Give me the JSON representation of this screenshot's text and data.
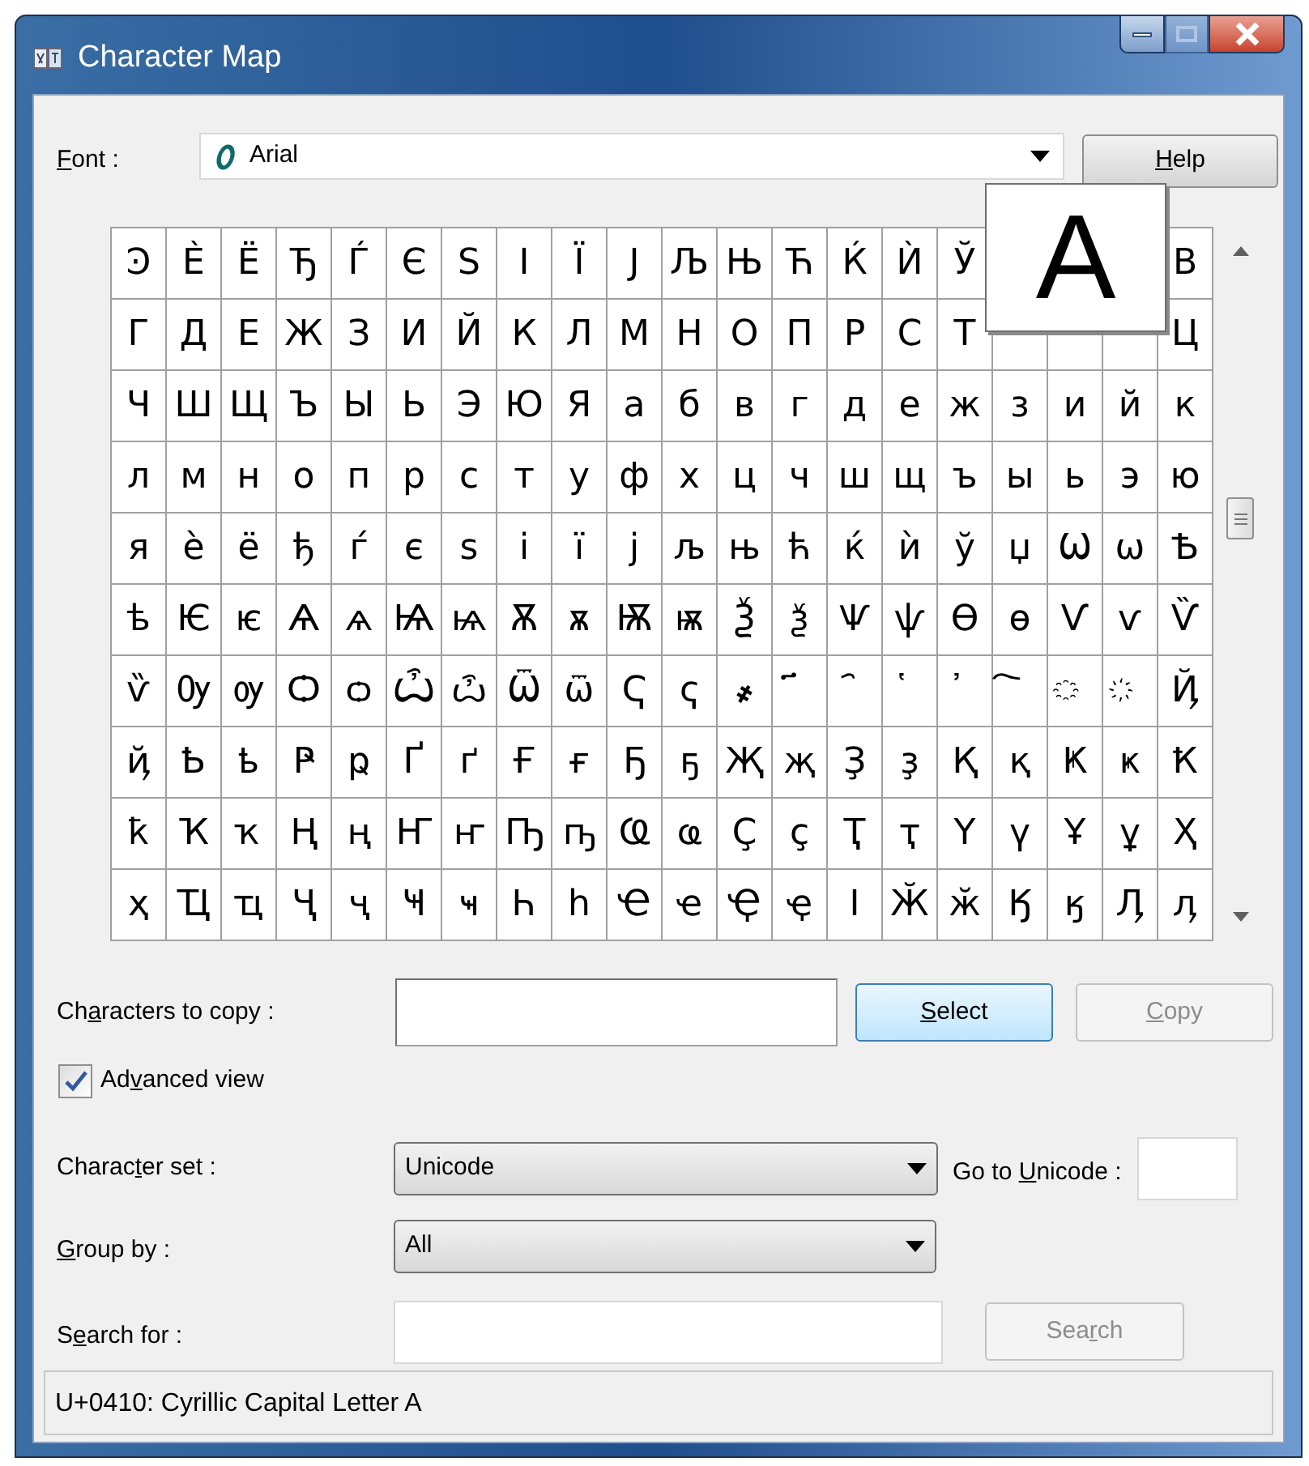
{
  "window": {
    "title": "Character Map",
    "buttons": [
      {
        "kind": "minimize",
        "disabled": false
      },
      {
        "kind": "maximize",
        "disabled": true
      },
      {
        "kind": "close",
        "disabled": false
      }
    ]
  },
  "font": {
    "label": {
      "key": "F",
      "after": "ont :"
    },
    "value": "Arial"
  },
  "help_button": {
    "key": "H",
    "after": "elp"
  },
  "grid": {
    "rows": [
      [
        "Ͽ",
        "Ѐ",
        "Ё",
        "Ђ",
        "Ѓ",
        "Є",
        "Ѕ",
        "І",
        "Ї",
        "Ј",
        "Љ",
        "Њ",
        "Ћ",
        "Ќ",
        "Ѝ",
        "Ў",
        null,
        null,
        null,
        "В"
      ],
      [
        "Г",
        "Д",
        "Е",
        "Ж",
        "З",
        "И",
        "Й",
        "К",
        "Л",
        "М",
        "Н",
        "О",
        "П",
        "Р",
        "С",
        "Т",
        null,
        null,
        null,
        "Ц"
      ],
      [
        "Ч",
        "Ш",
        "Щ",
        "Ъ",
        "Ы",
        "Ь",
        "Э",
        "Ю",
        "Я",
        "а",
        "б",
        "в",
        "г",
        "д",
        "е",
        "ж",
        "з",
        "и",
        "й",
        "к"
      ],
      [
        "л",
        "м",
        "н",
        "о",
        "п",
        "р",
        "с",
        "т",
        "у",
        "ф",
        "х",
        "ц",
        "ч",
        "ш",
        "щ",
        "ъ",
        "ы",
        "ь",
        "э",
        "ю"
      ],
      [
        "я",
        "ѐ",
        "ё",
        "ђ",
        "ѓ",
        "є",
        "ѕ",
        "і",
        "ї",
        "ј",
        "љ",
        "њ",
        "ћ",
        "ќ",
        "ѝ",
        "ў",
        "џ",
        "Ѡ",
        "ѡ",
        "Ѣ"
      ],
      [
        "ѣ",
        "Ѥ",
        "ѥ",
        "Ѧ",
        "ѧ",
        "Ѩ",
        "ѩ",
        "Ѫ",
        "ѫ",
        "Ѭ",
        "ѭ",
        "Ѯ",
        "ѯ",
        "Ѱ",
        "ѱ",
        "Ѳ",
        "ѳ",
        "Ѵ",
        "ѵ",
        "Ѷ"
      ],
      [
        "ѷ",
        "Ѹ",
        "ѹ",
        "Ѻ",
        "ѻ",
        "Ѽ",
        "ѽ",
        "Ѿ",
        "ѿ",
        "Ҁ",
        "ҁ",
        "҂",
        "҃",
        "҄",
        "҅",
        "҆",
        "҇",
        "҈",
        "҉",
        "Ҋ"
      ],
      [
        "ҋ",
        "Ҍ",
        "ҍ",
        "Ҏ",
        "ҏ",
        "Ґ",
        "ґ",
        "Ғ",
        "ғ",
        "Ҕ",
        "ҕ",
        "Җ",
        "җ",
        "Ҙ",
        "ҙ",
        "Қ",
        "қ",
        "Ҝ",
        "ҝ",
        "Ҟ"
      ],
      [
        "ҟ",
        "Ҡ",
        "ҡ",
        "Ң",
        "ң",
        "Ҥ",
        "ҥ",
        "Ҧ",
        "ҧ",
        "Ҩ",
        "ҩ",
        "Ҫ",
        "ҫ",
        "Ҭ",
        "ҭ",
        "Ү",
        "ү",
        "Ұ",
        "ұ",
        "Ҳ"
      ],
      [
        "ҳ",
        "Ҵ",
        "ҵ",
        "Ҷ",
        "ҷ",
        "Ҹ",
        "ҹ",
        "Һ",
        "һ",
        "Ҽ",
        "ҽ",
        "Ҿ",
        "ҿ",
        "Ӏ",
        "Ӂ",
        "ӂ",
        "Ӄ",
        "ӄ",
        "Ӆ",
        "ӆ"
      ]
    ],
    "magnified": "А"
  },
  "copy_row": {
    "label": {
      "before": "Ch",
      "key": "a",
      "after": "racters to copy :"
    },
    "select_button": {
      "key": "S",
      "after": "elect"
    },
    "copy_button": {
      "label": {
        "key": "C",
        "after": "opy"
      },
      "disabled": true
    }
  },
  "advanced_view": {
    "label": {
      "before": "Ad",
      "key": "v",
      "after": "anced view"
    },
    "checked": true
  },
  "character_set": {
    "label": {
      "before": "Charac",
      "key": "t",
      "after": "er set :"
    },
    "value": "Unicode"
  },
  "go_to_unicode": {
    "label": {
      "before": "Go to ",
      "key": "U",
      "after": "nicode :"
    }
  },
  "group_by": {
    "label": {
      "key": "G",
      "after": "roup by :"
    },
    "value": "All"
  },
  "search": {
    "label": {
      "before": "S",
      "key": "e",
      "after": "arch for :"
    },
    "button": {
      "label": {
        "before": "Sea",
        "key": "r",
        "after": "ch"
      },
      "disabled": true
    }
  },
  "status_bar": "U+0410: Cyrillic Capital Letter A"
}
